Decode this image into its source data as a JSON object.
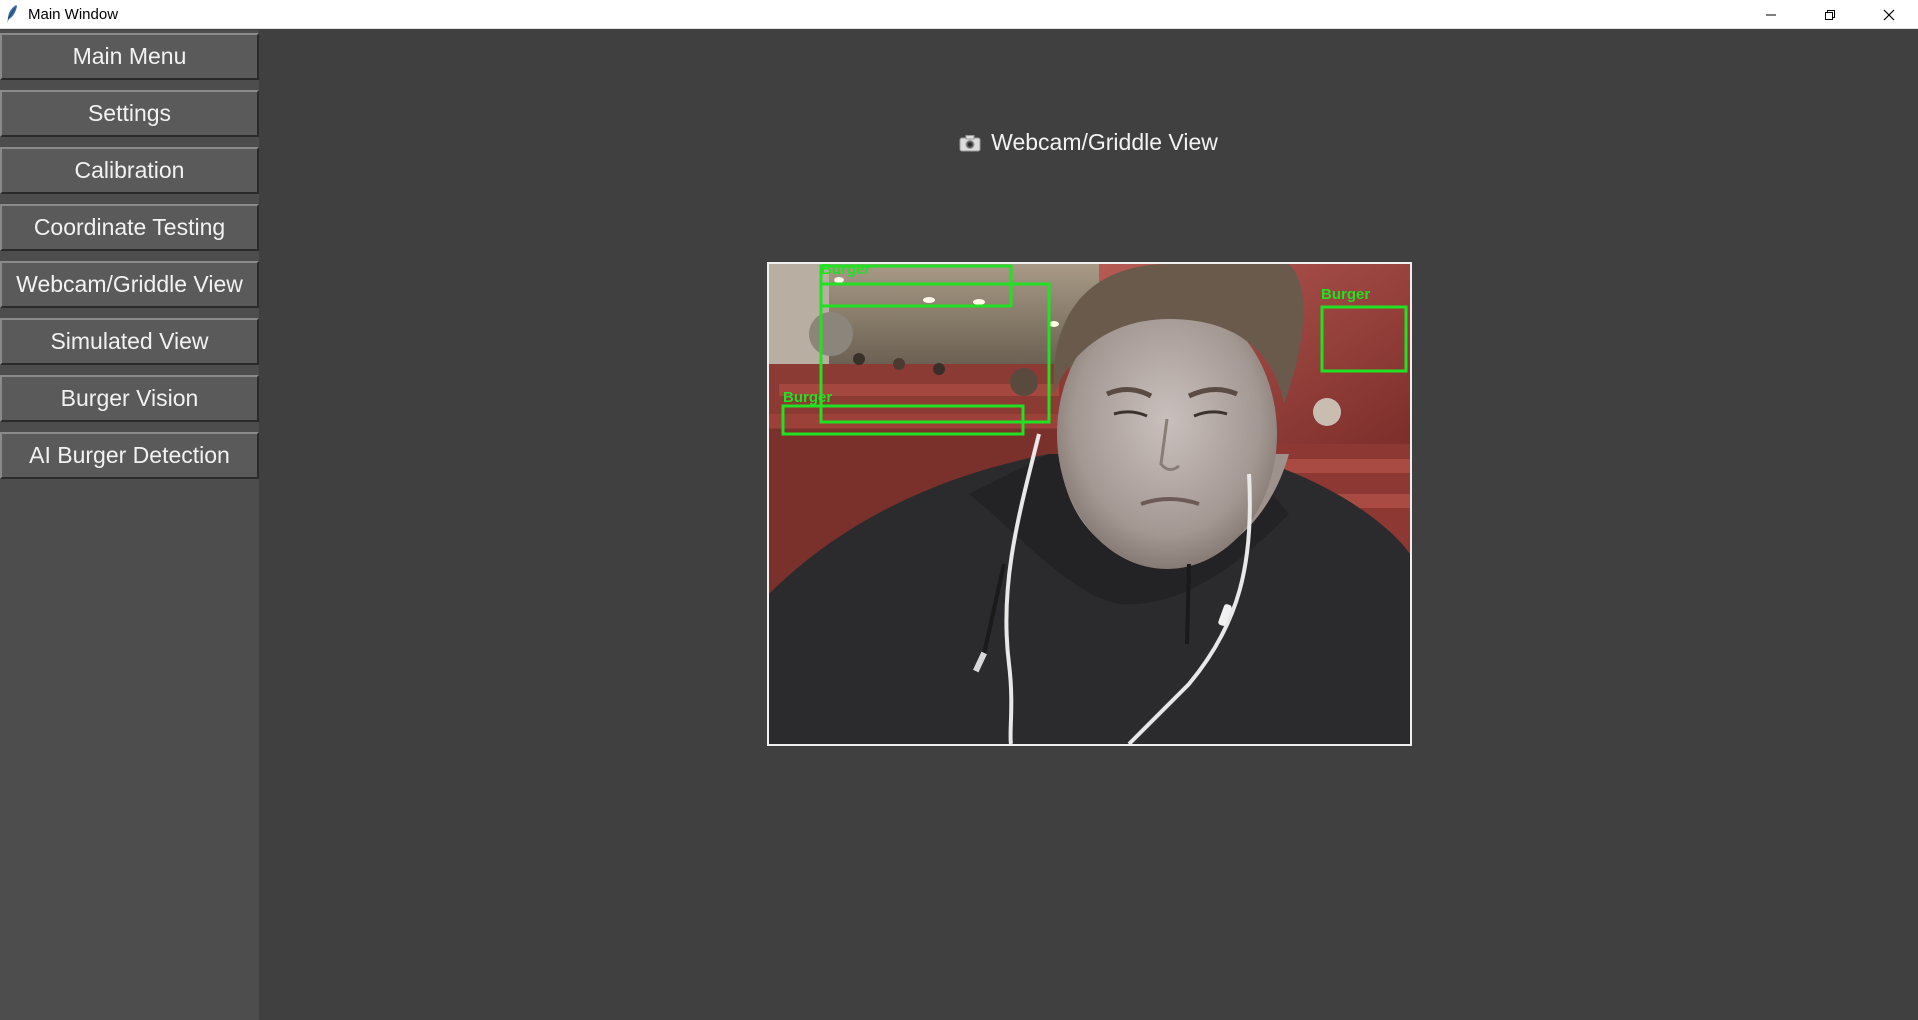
{
  "window": {
    "title": "Main Window"
  },
  "sidebar": {
    "items": [
      {
        "label": "Main Menu"
      },
      {
        "label": "Settings"
      },
      {
        "label": "Calibration"
      },
      {
        "label": "Coordinate Testing"
      },
      {
        "label": "Webcam/Griddle View"
      },
      {
        "label": "Simulated View"
      },
      {
        "label": "Burger Vision"
      },
      {
        "label": "AI Burger Detection"
      }
    ]
  },
  "main": {
    "heading": "Webcam/Griddle View",
    "heading_icon": "camera-icon"
  },
  "feed": {
    "detections": [
      {
        "label": "Burger"
      },
      {
        "label": "Burger"
      },
      {
        "label": "Burger"
      },
      {
        "label": "Burger"
      }
    ],
    "detection_color": "#22e022"
  },
  "colors": {
    "background": "#404040",
    "sidebar": "#4d4d4d",
    "button": "#5a5a5a",
    "text": "#f2f2f2"
  }
}
